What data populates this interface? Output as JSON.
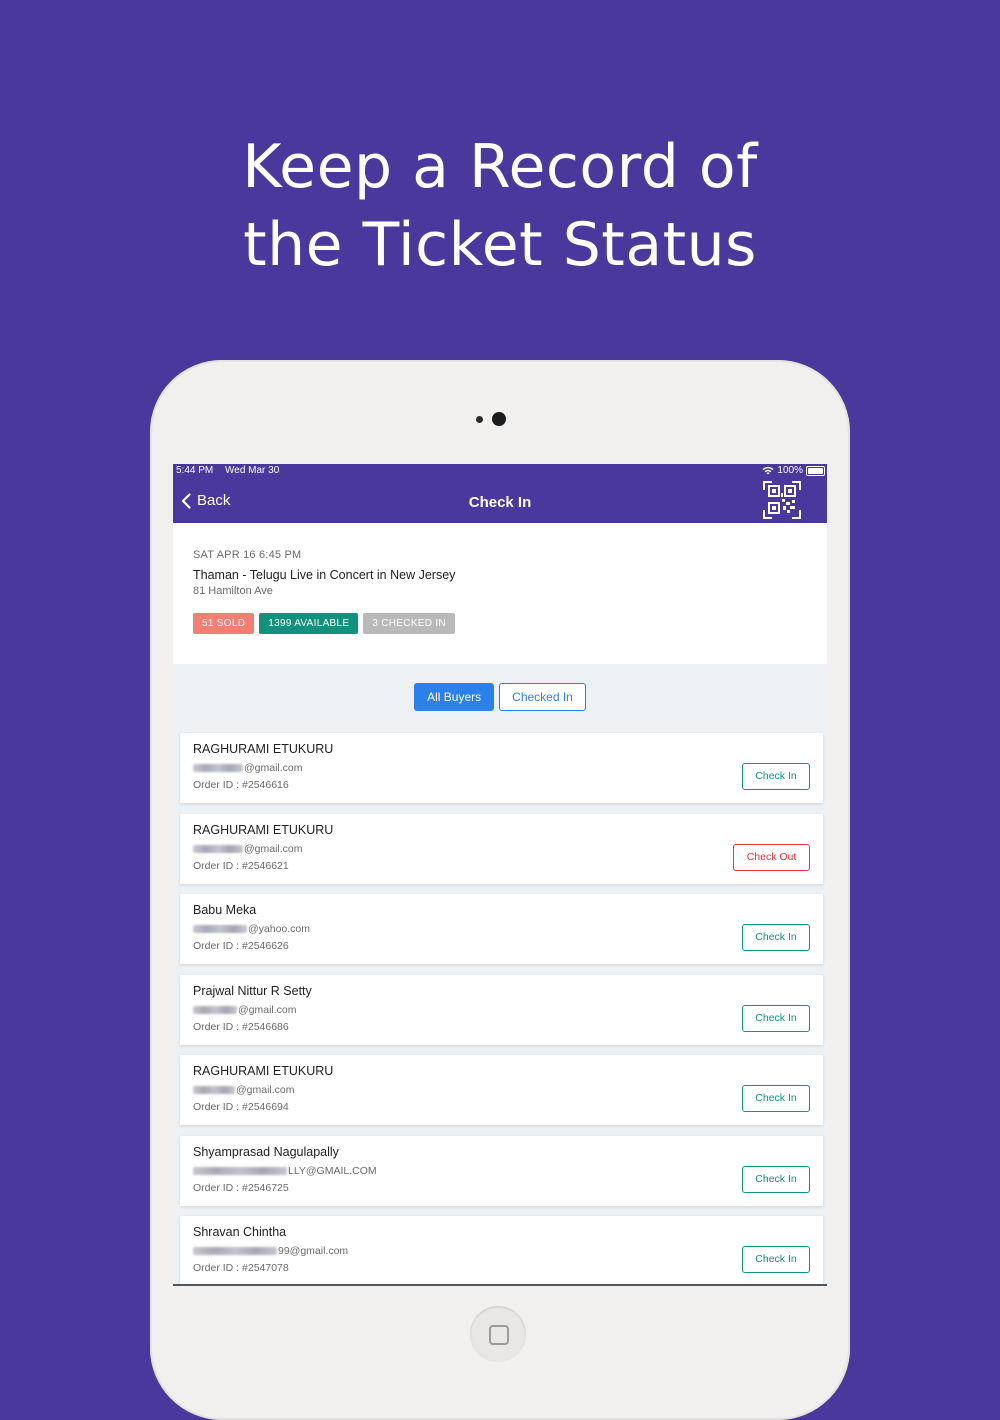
{
  "headline": {
    "line1": "Keep a Record of",
    "line2": "the Ticket Status"
  },
  "status_bar": {
    "time": "5:44 PM",
    "date": "Wed Mar 30",
    "battery": "100%"
  },
  "nav": {
    "back_label": "Back",
    "title": "Check In",
    "back_icon": "chevron-left-icon",
    "qr_icon": "qr-code-icon"
  },
  "event": {
    "date": "SAT APR 16 6:45 PM",
    "name": "Thaman - Telugu Live in Concert in New Jersey",
    "venue": "81 Hamilton Ave",
    "badges": {
      "sold": "51 SOLD",
      "available": "1399 AVAILABLE",
      "checked_in": "3 CHECKED IN"
    }
  },
  "tabs": {
    "all_buyers": "All Buyers",
    "checked_in": "Checked In",
    "active": "all_buyers"
  },
  "buyers": [
    {
      "name": "RAGHURAMI ETUKURU",
      "email_domain": "@gmail.com",
      "order": "Order ID : #2546616",
      "action": "Check In"
    },
    {
      "name": "RAGHURAMI ETUKURU",
      "email_domain": "@gmail.com",
      "order": "Order ID : #2546621",
      "action": "Check Out"
    },
    {
      "name": "Babu Meka",
      "email_domain": "@yahoo.com",
      "order": "Order ID : #2546626",
      "action": "Check In"
    },
    {
      "name": "Prajwal Nittur R Setty",
      "email_domain": "@gmail.com",
      "order": "Order ID : #2546686",
      "action": "Check In"
    },
    {
      "name": "RAGHURAMI ETUKURU",
      "email_domain": "@gmail.com",
      "order": "Order ID : #2546694",
      "action": "Check In"
    },
    {
      "name": "Shyamprasad Nagulapally",
      "email_domain": "LLY@GMAIL.COM",
      "order": "Order ID : #2546725",
      "action": "Check In"
    },
    {
      "name": "Shravan Chintha",
      "email_domain": "99@gmail.com",
      "order": "Order ID : #2547078",
      "action": "Check In"
    }
  ],
  "colors": {
    "brand": "#4a389c",
    "sold": "#f47d74",
    "available": "#12917d",
    "checked": "#b9b9b9",
    "primary": "#2c80ea",
    "checkout": "#e5343d"
  }
}
